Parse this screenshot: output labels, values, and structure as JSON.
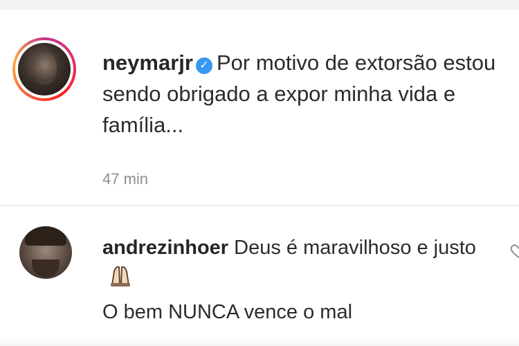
{
  "post": {
    "username": "neymarjr",
    "verified": true,
    "verified_icon": "verified-badge-icon",
    "caption": "Por motivo de extorsão estou sendo obrigado a expor minha vida e família...",
    "time": "47 min",
    "colors": {
      "verified": "#3897f0",
      "story_ring": [
        "#c13584",
        "#e1306c",
        "#fd1d1d",
        "#f56040",
        "#fcaf45"
      ]
    }
  },
  "comment": {
    "username": "andrezinhoer",
    "text_part1": "Deus é maravilhoso e justo",
    "emoji": "🙏",
    "emoji_icon": "praying-hands-icon",
    "text_part2": "O bem NUNCA vence o mal",
    "like_icon": "heart-icon"
  }
}
